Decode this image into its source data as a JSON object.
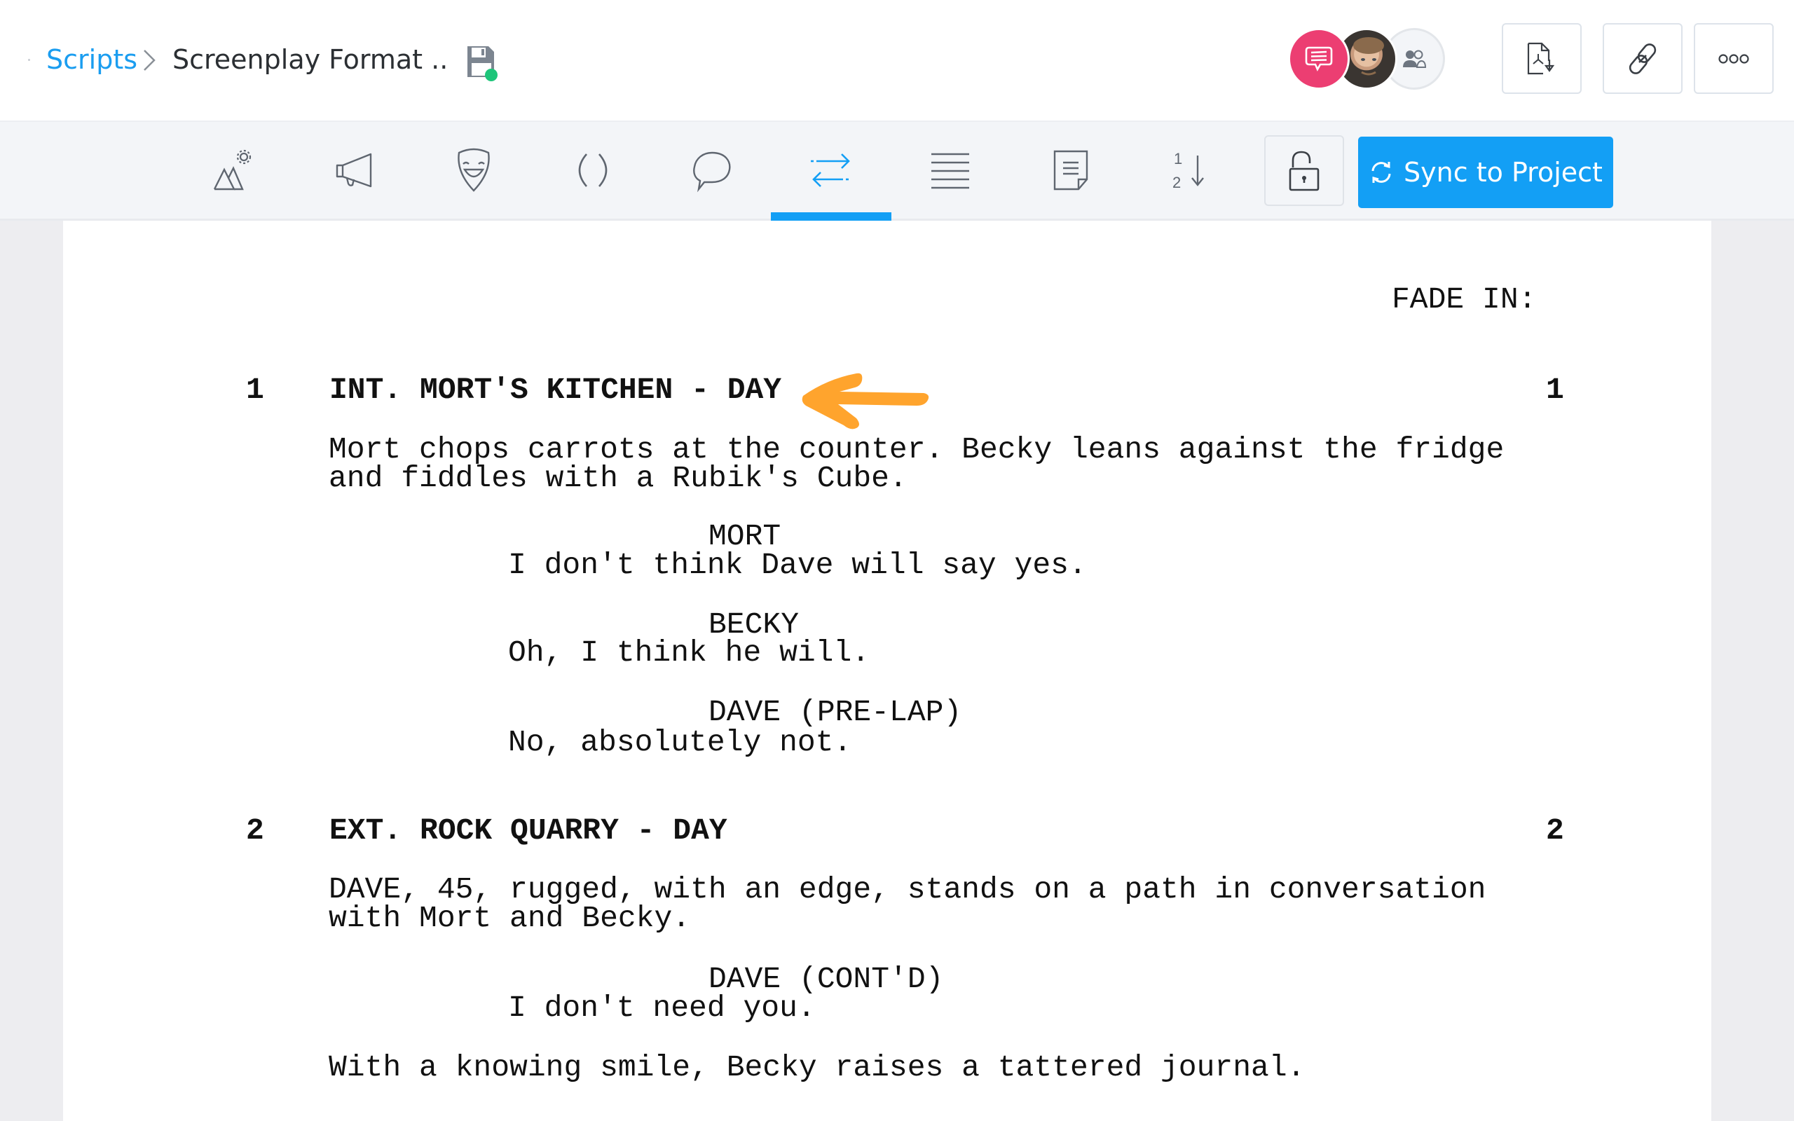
{
  "header": {
    "breadcrumb": {
      "root": "Scripts",
      "current": "Screenplay Format .."
    },
    "save_status": "saved",
    "collaborators": [
      {
        "type": "comments",
        "icon": "comments-icon",
        "color": "#ec3e72"
      },
      {
        "type": "user-photo",
        "icon": "user-avatar"
      },
      {
        "type": "team",
        "icon": "team-icon"
      }
    ],
    "actions": [
      {
        "name": "export-pdf",
        "icon": "pdf-download-icon"
      },
      {
        "name": "share-link",
        "icon": "link-icon"
      },
      {
        "name": "more",
        "icon": "more-icon"
      }
    ]
  },
  "toolbar": {
    "tools": [
      {
        "name": "scene-heading",
        "icon": "scene-heading-icon",
        "active": false
      },
      {
        "name": "action",
        "icon": "megaphone-icon",
        "active": false
      },
      {
        "name": "character",
        "icon": "mask-icon",
        "active": false
      },
      {
        "name": "parenthetical",
        "icon": "parentheses-icon",
        "active": false
      },
      {
        "name": "dialogue",
        "icon": "speech-bubble-icon",
        "active": false
      },
      {
        "name": "transition",
        "icon": "transition-icon",
        "active": true
      },
      {
        "name": "general",
        "icon": "lines-icon",
        "active": false
      },
      {
        "name": "note",
        "icon": "note-icon",
        "active": false
      },
      {
        "name": "scene-numbering",
        "icon": "numbering-icon",
        "active": false
      }
    ],
    "lock_state": "unlocked",
    "sync_label": "Sync to Project",
    "accent_color": "#139ff5"
  },
  "script": {
    "fade_in": "FADE IN:",
    "scenes": [
      {
        "number": "1",
        "heading": "INT. MORT'S KITCHEN - DAY",
        "action": [
          "Mort chops carrots at the counter. Becky leans against the fridge",
          "and fiddles with a Rubik's Cube."
        ],
        "dialogue": [
          {
            "character": "MORT",
            "line": "I don't think Dave will say yes."
          },
          {
            "character": "BECKY",
            "line": "Oh, I think he will."
          },
          {
            "character": "DAVE (PRE-LAP)",
            "line": "No, absolutely not."
          }
        ]
      },
      {
        "number": "2",
        "heading": "EXT. ROCK QUARRY - DAY",
        "action": [
          "DAVE, 45, rugged, with an edge, stands on a path in conversation",
          "with Mort and Becky."
        ],
        "dialogue": [
          {
            "character": "DAVE (CONT'D)",
            "line": "I don't need you."
          }
        ],
        "action_after": "With a knowing smile, Becky raises a tattered journal."
      }
    ],
    "annotation": {
      "type": "arrow",
      "color": "#ffa42d",
      "points_to": "scene 1 heading"
    }
  }
}
